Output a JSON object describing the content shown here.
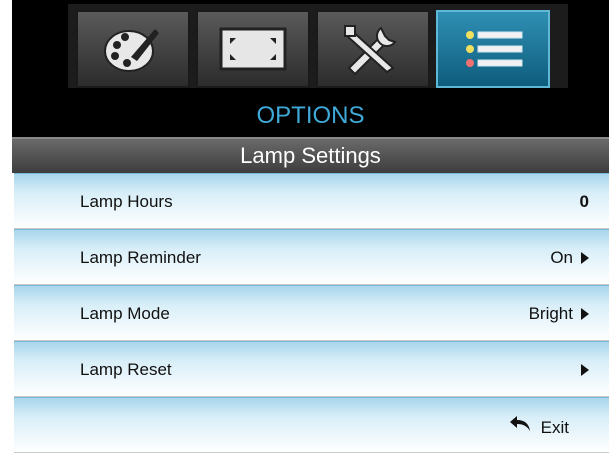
{
  "header": {
    "tabs": [
      {
        "icon": "palette-icon",
        "active": false
      },
      {
        "icon": "screen-fit-icon",
        "active": false
      },
      {
        "icon": "tools-icon",
        "active": false
      },
      {
        "icon": "options-list-icon",
        "active": true
      }
    ]
  },
  "menu": {
    "title": "OPTIONS",
    "subtitle": "Lamp Settings",
    "items": [
      {
        "label": "Lamp Hours",
        "value": "0"
      },
      {
        "label": "Lamp Reminder",
        "value": "On"
      },
      {
        "label": "Lamp Mode",
        "value": "Bright"
      },
      {
        "label": "Lamp Reset",
        "value": ""
      }
    ],
    "exit_label": "Exit"
  },
  "colors": {
    "title": "#3fa9d8",
    "active_tab": "#1a78a0",
    "row_highlight": "#a9d6ec"
  }
}
